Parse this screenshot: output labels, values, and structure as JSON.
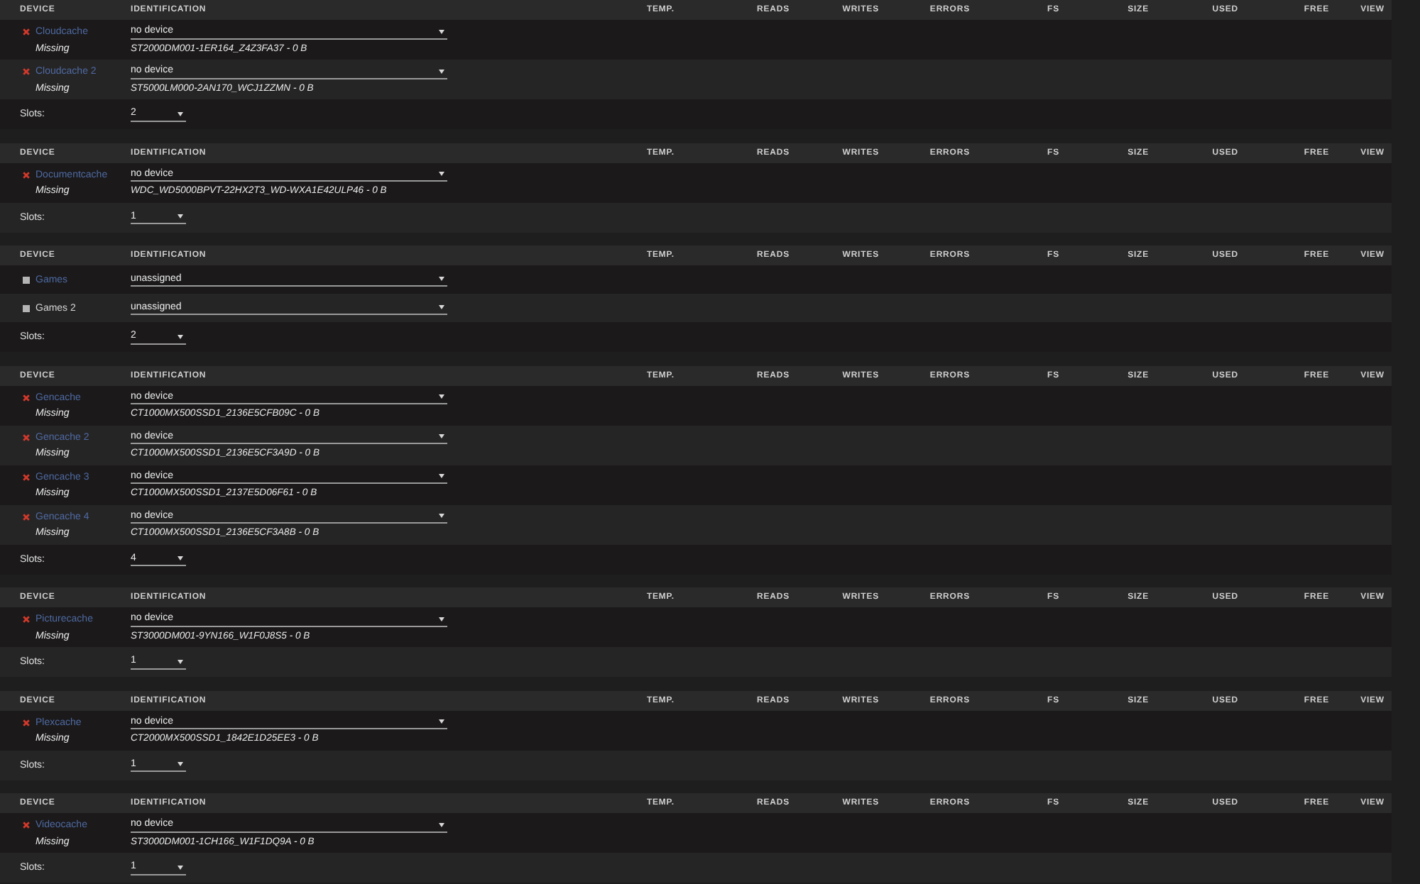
{
  "pools": [
    {
      "columns": [
        "DEVICE",
        "IDENTIFICATION",
        "TEMP.",
        "READS",
        "WRITES",
        "ERRORS",
        "FS",
        "SIZE",
        "USED",
        "FREE",
        "VIEW"
      ],
      "devices": [
        {
          "name": "Cloudcache",
          "kind": "missing",
          "linked": true,
          "note": "Missing",
          "selection": "no device",
          "identification": "ST2000DM001-1ER164_Z4Z3FA37 - 0 B"
        },
        {
          "name": "Cloudcache 2",
          "kind": "missing",
          "linked": true,
          "note": "Missing",
          "selection": "no device",
          "identification": "ST5000LM000-2AN170_WCJ1ZZMN - 0 B"
        }
      ],
      "slots": {
        "label": "Slots:",
        "value": "2"
      }
    },
    {
      "columns": [
        "DEVICE",
        "IDENTIFICATION",
        "TEMP.",
        "READS",
        "WRITES",
        "ERRORS",
        "FS",
        "SIZE",
        "USED",
        "FREE",
        "VIEW"
      ],
      "devices": [
        {
          "name": "Documentcache",
          "kind": "missing",
          "linked": true,
          "note": "Missing",
          "selection": "no device",
          "identification": "WDC_WD5000BPVT-22HX2T3_WD-WXA1E42ULP46 - 0 B"
        }
      ],
      "slots": {
        "label": "Slots:",
        "value": "1"
      }
    },
    {
      "columns": [
        "DEVICE",
        "IDENTIFICATION",
        "TEMP.",
        "READS",
        "WRITES",
        "ERRORS",
        "FS",
        "SIZE",
        "USED",
        "FREE",
        "VIEW"
      ],
      "devices": [
        {
          "name": "Games",
          "kind": "unassigned",
          "linked": true,
          "selection": "unassigned"
        },
        {
          "name": "Games 2",
          "kind": "unassigned",
          "linked": false,
          "selection": "unassigned"
        }
      ],
      "slots": {
        "label": "Slots:",
        "value": "2"
      }
    },
    {
      "columns": [
        "DEVICE",
        "IDENTIFICATION",
        "TEMP.",
        "READS",
        "WRITES",
        "ERRORS",
        "FS",
        "SIZE",
        "USED",
        "FREE",
        "VIEW"
      ],
      "devices": [
        {
          "name": "Gencache",
          "kind": "missing",
          "linked": true,
          "note": "Missing",
          "selection": "no device",
          "identification": "CT1000MX500SSD1_2136E5CFB09C - 0 B"
        },
        {
          "name": "Gencache 2",
          "kind": "missing",
          "linked": true,
          "note": "Missing",
          "selection": "no device",
          "identification": "CT1000MX500SSD1_2136E5CF3A9D - 0 B"
        },
        {
          "name": "Gencache 3",
          "kind": "missing",
          "linked": true,
          "note": "Missing",
          "selection": "no device",
          "identification": "CT1000MX500SSD1_2137E5D06F61 - 0 B"
        },
        {
          "name": "Gencache 4",
          "kind": "missing",
          "linked": true,
          "note": "Missing",
          "selection": "no device",
          "identification": "CT1000MX500SSD1_2136E5CF3A8B - 0 B"
        }
      ],
      "slots": {
        "label": "Slots:",
        "value": "4"
      }
    },
    {
      "columns": [
        "DEVICE",
        "IDENTIFICATION",
        "TEMP.",
        "READS",
        "WRITES",
        "ERRORS",
        "FS",
        "SIZE",
        "USED",
        "FREE",
        "VIEW"
      ],
      "devices": [
        {
          "name": "Picturecache",
          "kind": "missing",
          "linked": true,
          "note": "Missing",
          "selection": "no device",
          "identification": "ST3000DM001-9YN166_W1F0J8S5 - 0 B"
        }
      ],
      "slots": {
        "label": "Slots:",
        "value": "1"
      }
    },
    {
      "columns": [
        "DEVICE",
        "IDENTIFICATION",
        "TEMP.",
        "READS",
        "WRITES",
        "ERRORS",
        "FS",
        "SIZE",
        "USED",
        "FREE",
        "VIEW"
      ],
      "devices": [
        {
          "name": "Plexcache",
          "kind": "missing",
          "linked": true,
          "note": "Missing",
          "selection": "no device",
          "identification": "CT2000MX500SSD1_1842E1D25EE3 - 0 B"
        }
      ],
      "slots": {
        "label": "Slots:",
        "value": "1"
      }
    },
    {
      "columns": [
        "DEVICE",
        "IDENTIFICATION",
        "TEMP.",
        "READS",
        "WRITES",
        "ERRORS",
        "FS",
        "SIZE",
        "USED",
        "FREE",
        "VIEW"
      ],
      "devices": [
        {
          "name": "Videocache",
          "kind": "missing",
          "linked": true,
          "note": "Missing",
          "selection": "no device",
          "identification": "ST3000DM001-1CH166_W1F1DQ9A - 0 B"
        }
      ],
      "slots": {
        "label": "Slots:",
        "value": "1"
      }
    }
  ]
}
